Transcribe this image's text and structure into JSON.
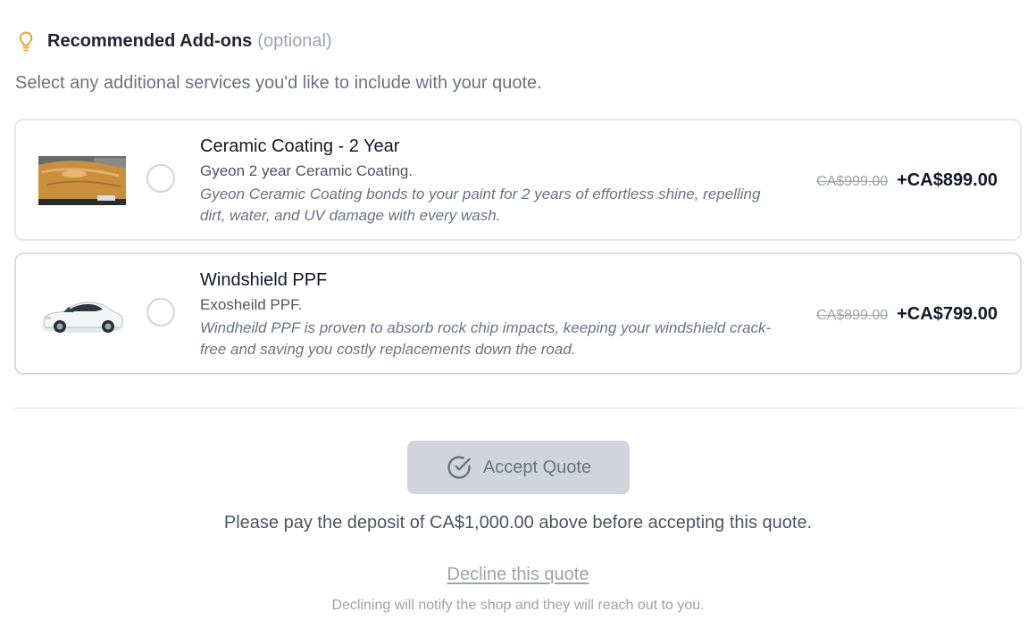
{
  "addons_section": {
    "icon": "lightbulb-icon",
    "icon_color": "#f0a030",
    "title": "Recommended Add-ons",
    "optional_label": "(optional)",
    "subtitle": "Select any additional services you'd like to include with your quote."
  },
  "addons": [
    {
      "name": "Ceramic Coating - 2 Year",
      "brand": "Gyeon 2 year Ceramic Coating.",
      "description": "Gyeon Ceramic Coating bonds to your paint for 2 years of effortless shine, repelling dirt, water, and UV damage with every wash.",
      "old_price": "CA$999.00",
      "price": "+CA$899.00",
      "selected": false,
      "image": "ceramic-coated-car-hood-photo"
    },
    {
      "name": "Windshield PPF",
      "brand": "Exosheild PPF.",
      "description": "Windheild PPF is proven to absorb rock chip impacts, keeping your windshield crack-free and saving you costly replacements down the road.",
      "old_price": "CA$899.00",
      "price": "+CA$799.00",
      "selected": false,
      "image": "white-suv-photo"
    }
  ],
  "actions": {
    "accept_label": "Accept Quote",
    "accept_icon": "check-circle-icon",
    "accept_disabled": true,
    "deposit_note": "Please pay the deposit of CA$1,000.00 above before accepting this quote.",
    "decline_label": "Decline this quote",
    "decline_note": "Declining will notify the shop and they will reach out to you."
  },
  "colors": {
    "accent_icon": "#f0a030",
    "button_disabled_bg": "#d1d5db",
    "muted_text": "#9ca3af"
  }
}
